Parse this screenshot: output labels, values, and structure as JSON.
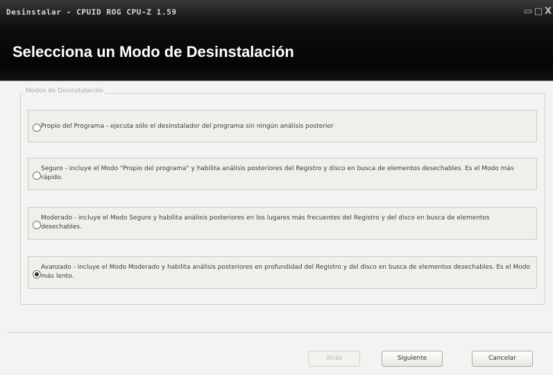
{
  "window": {
    "title": "Desinstalar - CPUID ROG CPU-Z 1.59",
    "minimize_glyph": "▭",
    "maximize_glyph": "□",
    "close_glyph": "X"
  },
  "header": {
    "title": "Selecciona un Modo de Desinstalación"
  },
  "group": {
    "legend": "Modos de Desinstalación",
    "options": [
      {
        "label": "Propio del Programa - ejecuta sólo el desinstalador del programa sin ningún análisis posterior",
        "selected": false
      },
      {
        "label": "Seguro - incluye el Modo \"Propio del programa\" y habilita análisis posteriores del Registro y disco en busca de elementos desechables. Es el Modo más rápido.",
        "selected": false
      },
      {
        "label": "Moderado - incluye el Modo Seguro y habilita análisis posteriores en los lugares más frecuentes del Registro y del disco en busca de elementos desechables.",
        "selected": false
      },
      {
        "label": "Avanzado - incluye el Modo Moderado y habilita análisis posteriores en profundidad del Registro y del disco en busca de elementos desechables. Es el Modo más lento.",
        "selected": true
      }
    ]
  },
  "footer": {
    "back_label": "Atrás",
    "next_label": "Siguiente",
    "cancel_label": "Cancelar"
  },
  "colors": {
    "title_bar": "#1e1e1e",
    "header_bg": "#050505",
    "header_text": "#ffffff",
    "body_bg": "#f3f3f1"
  },
  "icons": [
    "minimize-icon",
    "maximize-icon",
    "close-icon",
    "radio-icon"
  ]
}
